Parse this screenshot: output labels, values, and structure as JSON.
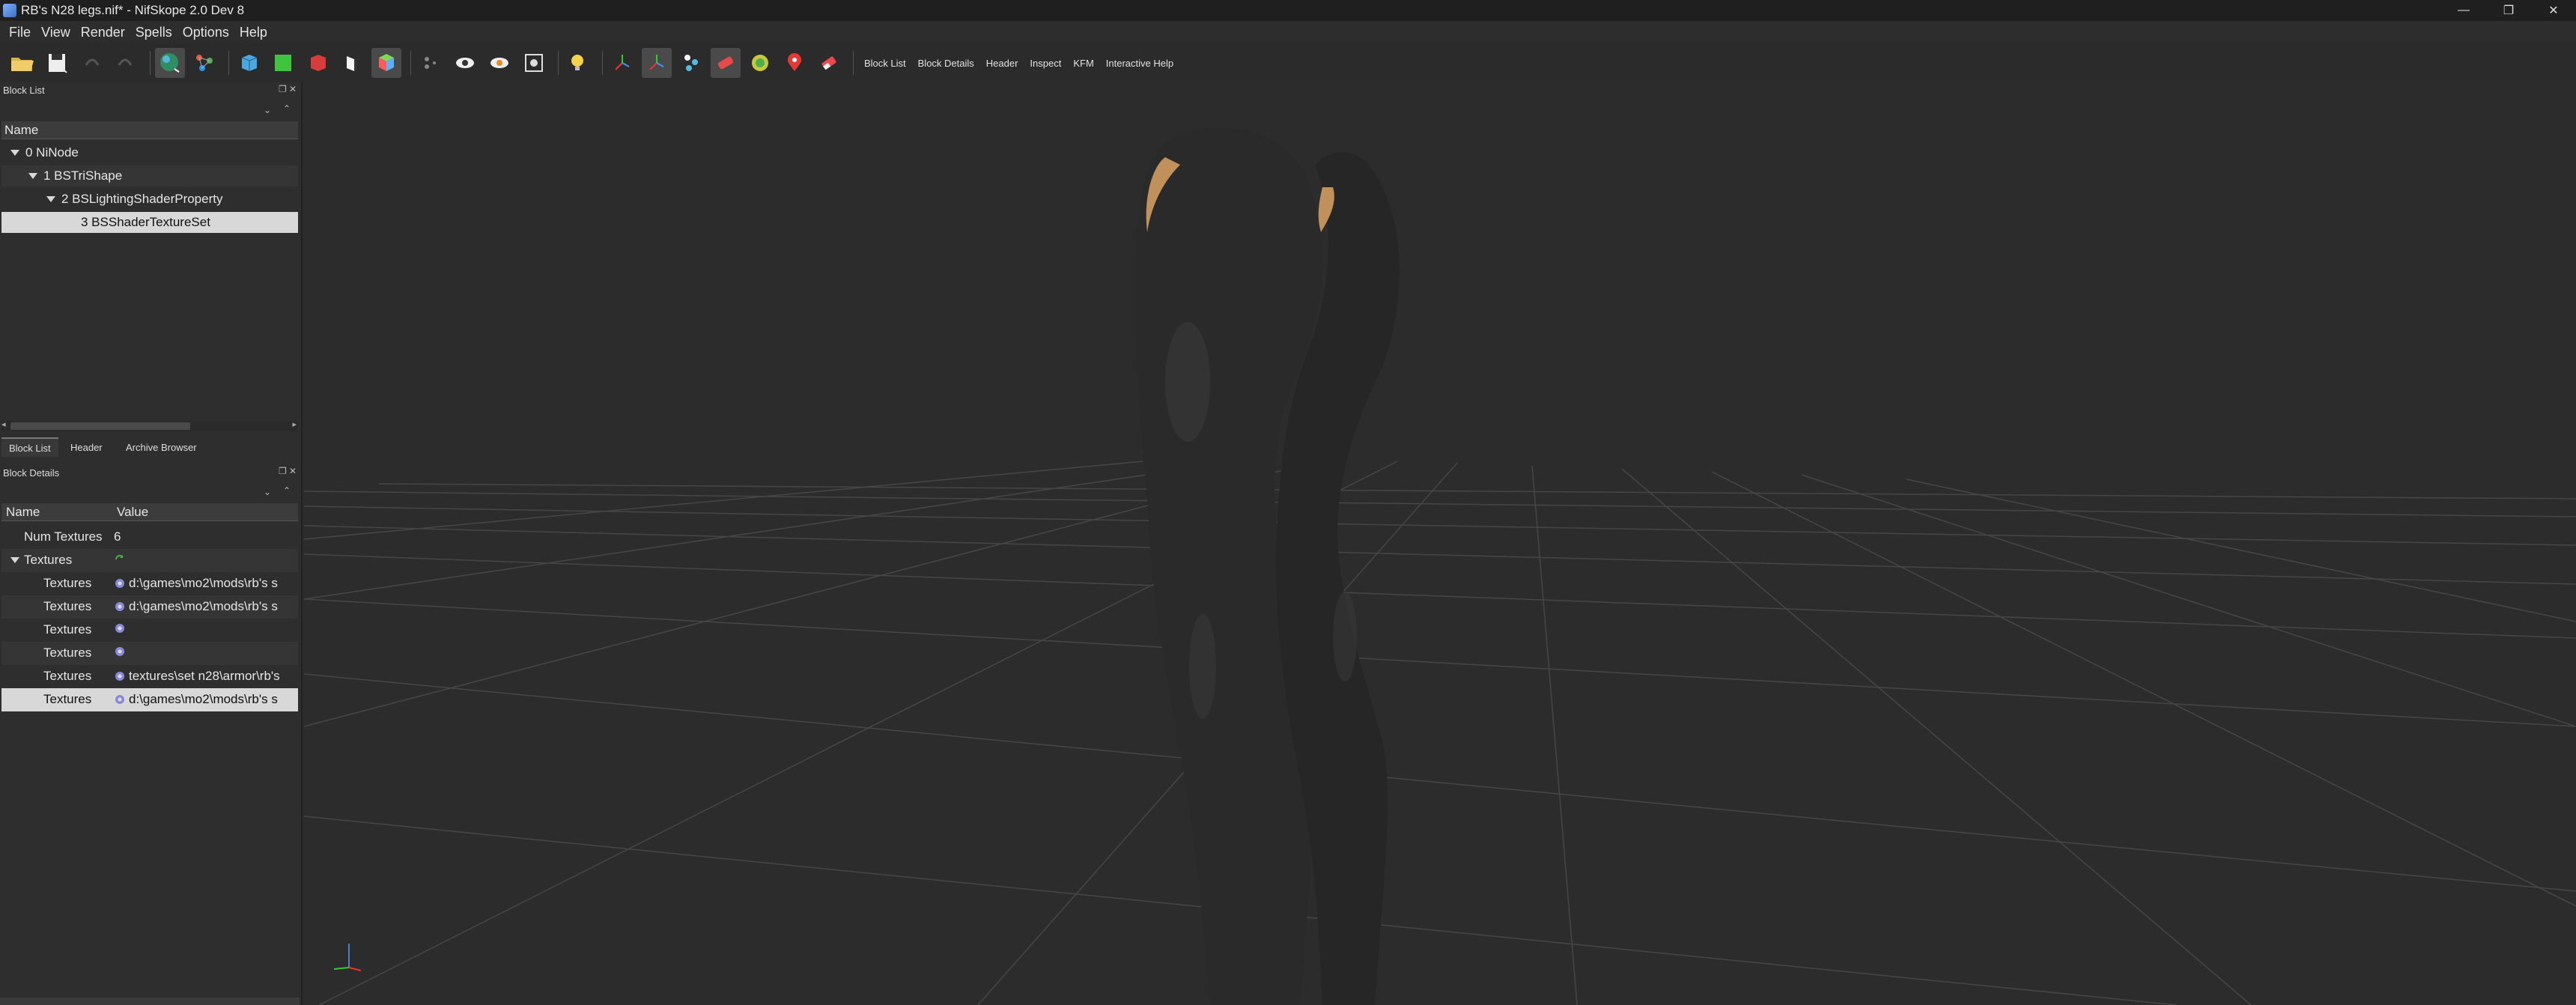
{
  "window": {
    "title": "RB's N28 legs.nif* - NifSkope 2.0 Dev 8",
    "controls": [
      "—",
      "❐",
      "✕"
    ]
  },
  "menubar": {
    "items": [
      "File",
      "View",
      "Render",
      "Spells",
      "Options",
      "Help"
    ]
  },
  "toolbar": {
    "text_buttons": [
      "Block List",
      "Block Details",
      "Header",
      "Inspect",
      "KFM",
      "Interactive Help"
    ]
  },
  "block_list": {
    "title": "Block List",
    "column": "Name",
    "rows": [
      {
        "label": "0 NiNode",
        "level": 0,
        "expanded": true
      },
      {
        "label": "1 BSTriShape",
        "level": 1,
        "expanded": true
      },
      {
        "label": "2 BSLightingShaderProperty",
        "level": 2,
        "expanded": true
      },
      {
        "label": "3 BSShaderTextureSet",
        "level": 3,
        "selected": true
      }
    ]
  },
  "panel_tabs": [
    "Block List",
    "Header",
    "Archive Browser"
  ],
  "block_details": {
    "title": "Block Details",
    "columns": [
      "Name",
      "Value"
    ],
    "rows": [
      {
        "name": "Num Textures",
        "value": "6",
        "level": 0
      },
      {
        "name": "Textures",
        "value": "",
        "level": 0,
        "expanded": true
      },
      {
        "name": "Textures",
        "value": "d:\\games\\mo2\\mods\\rb's s",
        "level": 1
      },
      {
        "name": "Textures",
        "value": "d:\\games\\mo2\\mods\\rb's s",
        "level": 1
      },
      {
        "name": "Textures",
        "value": "",
        "level": 1
      },
      {
        "name": "Textures",
        "value": "",
        "level": 1
      },
      {
        "name": "Textures",
        "value": "textures\\set n28\\armor\\rb's",
        "level": 1
      },
      {
        "name": "Textures",
        "value": "d:\\games\\mo2\\mods\\rb's s",
        "level": 1,
        "selected": true
      }
    ]
  },
  "viewport": {
    "background": "#2c2c2c",
    "grid_color": "#4a4a4a",
    "model_color": "#2a2a2a"
  }
}
